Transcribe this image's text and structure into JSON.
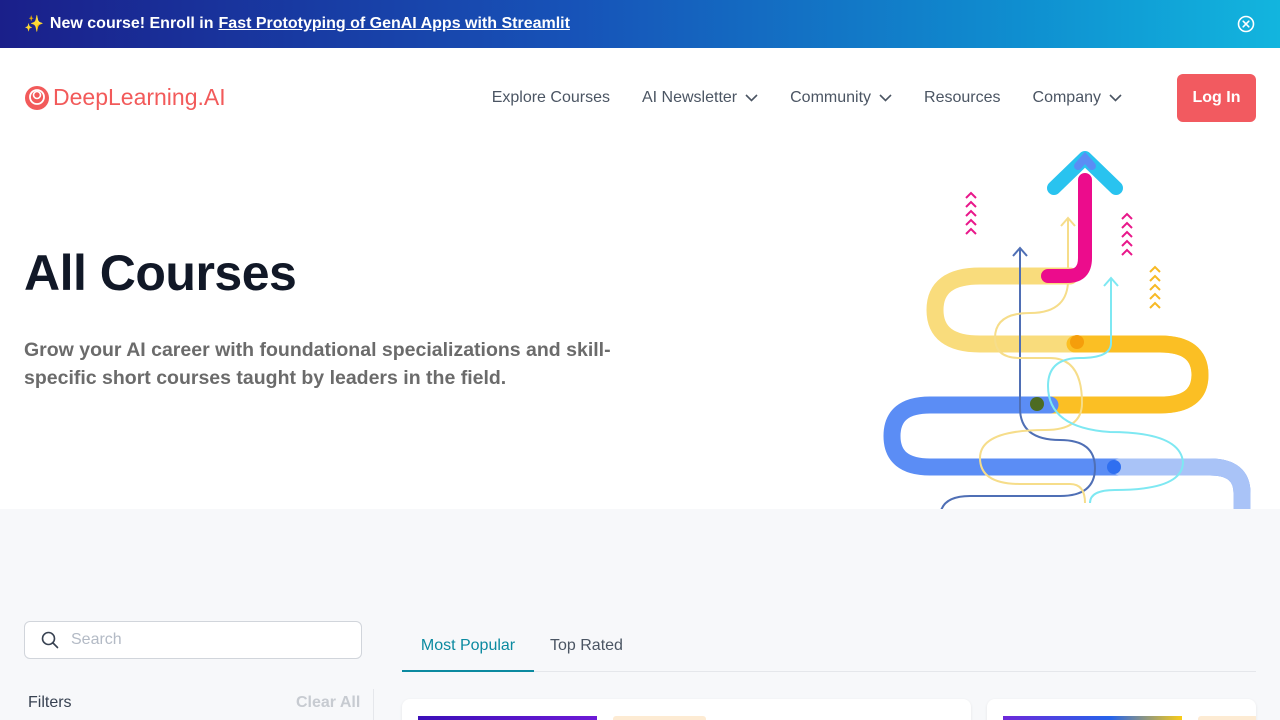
{
  "banner": {
    "prefix": "New course! Enroll in",
    "link_text": "Fast Prototyping of GenAI Apps with Streamlit"
  },
  "nav": {
    "logo_text": "DeepLearning.AI",
    "items": [
      {
        "label": "Explore Courses",
        "dropdown": false
      },
      {
        "label": "AI Newsletter",
        "dropdown": true
      },
      {
        "label": "Community",
        "dropdown": true
      },
      {
        "label": "Resources",
        "dropdown": false
      },
      {
        "label": "Company",
        "dropdown": true
      }
    ],
    "login_label": "Log In"
  },
  "hero": {
    "title": "All Courses",
    "subtitle": "Grow your AI career with foundational specializations and skill-specific short courses taught by leaders in the field."
  },
  "search": {
    "placeholder": "Search"
  },
  "filters": {
    "label": "Filters",
    "clear_label": "Clear All"
  },
  "tabs": [
    {
      "label": "Most Popular",
      "active": true
    },
    {
      "label": "Top Rated",
      "active": false
    }
  ],
  "colors": {
    "brand": "#f25a60",
    "accent_tab": "#0b8aa0",
    "banner_start": "#1a1f8a",
    "banner_end": "#12b5de"
  }
}
